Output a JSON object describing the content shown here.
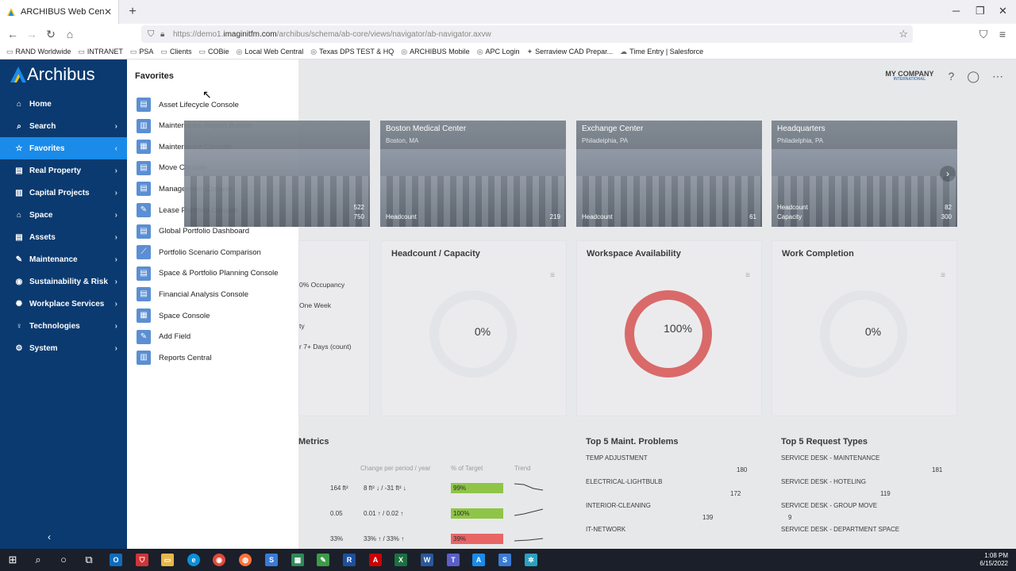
{
  "browser": {
    "tab_title": "ARCHIBUS Web Central:Home",
    "url_prefix": "https://demo1.",
    "url_host": "imaginitfm.com",
    "url_path": "/archibus/schema/ab-core/views/navigator/ab-navigator.axvw",
    "bookmarks": [
      {
        "icon": "folder-icon",
        "label": "RAND Worldwide"
      },
      {
        "icon": "folder-icon",
        "label": "INTRANET"
      },
      {
        "icon": "folder-icon",
        "label": "PSA"
      },
      {
        "icon": "folder-icon",
        "label": "Clients"
      },
      {
        "icon": "folder-icon",
        "label": "COBie"
      },
      {
        "icon": "globe-icon",
        "label": "Local Web Central"
      },
      {
        "icon": "globe-icon",
        "label": "Texas DPS TEST & HQ"
      },
      {
        "icon": "globe-icon",
        "label": "ARCHIBUS Mobile"
      },
      {
        "icon": "globe-icon",
        "label": "APC Login"
      },
      {
        "icon": "serraview-icon",
        "label": "Serraview CAD Prepar..."
      },
      {
        "icon": "salesforce-icon",
        "label": "Time Entry | Salesforce"
      }
    ]
  },
  "app": {
    "brand": "Archibus",
    "nav": [
      {
        "icon": "home-icon",
        "label": "Home",
        "chev": ""
      },
      {
        "icon": "search-icon",
        "label": "Search",
        "chev": "›"
      },
      {
        "icon": "star-icon",
        "label": "Favorites",
        "chev": "‹"
      },
      {
        "icon": "building-icon",
        "label": "Real Property",
        "chev": "›"
      },
      {
        "icon": "chart-icon",
        "label": "Capital Projects",
        "chev": "›"
      },
      {
        "icon": "space-icon",
        "label": "Space",
        "chev": "›"
      },
      {
        "icon": "assets-icon",
        "label": "Assets",
        "chev": "›"
      },
      {
        "icon": "wrench-icon",
        "label": "Maintenance",
        "chev": "›"
      },
      {
        "icon": "globe-icon",
        "label": "Sustainability & Risk",
        "chev": "›"
      },
      {
        "icon": "services-icon",
        "label": "Workplace Services",
        "chev": "›"
      },
      {
        "icon": "bulb-icon",
        "label": "Technologies",
        "chev": "›"
      },
      {
        "icon": "gear-icon",
        "label": "System",
        "chev": "›"
      }
    ],
    "favorites_title": "Favorites",
    "favorites": [
      "Asset Lifecycle Console",
      "Maintenance Report Builder",
      "Maintenance Console",
      "Move Console",
      "Management Console",
      "Lease Portfolio Console",
      "Global Portfolio Dashboard",
      "Portfolio Scenario Comparison",
      "Space & Portfolio Planning Console",
      "Financial Analysis Console",
      "Space Console",
      "Add Field",
      "Reports Central"
    ]
  },
  "dashboard": {
    "company": "MY COMPANY",
    "company_sub": "INTERNATIONAL",
    "buildings": [
      {
        "name": "",
        "location": "",
        "row1_label": "",
        "row1_value": "522",
        "row2_label": "",
        "row2_value": "750"
      },
      {
        "name": "Boston Medical Center",
        "location": "Boston, MA",
        "row1_label": "Headcount",
        "row1_value": "219"
      },
      {
        "name": "Exchange Center",
        "location": "Philadelphia, PA",
        "row1_label": "Headcount",
        "row1_value": "61"
      },
      {
        "name": "Headquarters",
        "location": "Philadelphia, PA",
        "row1_label": "Headcount",
        "row1_value": "82",
        "row2_label": "Capacity",
        "row2_value": "300"
      }
    ],
    "occupancy_lines": [
      "0% Occupancy",
      "One Week",
      "ty",
      "r 7+ Days (count)"
    ],
    "headcount_title": "Headcount / Capacity",
    "headcount_value": "0%",
    "workspace_title": "Workspace Availability",
    "workspace_value": "100%",
    "work_title": "Work Completion",
    "work_value": "0%",
    "metrics_title": "Metrics",
    "metrics_headers": {
      "change": "Change per period / year",
      "target": "% of Target",
      "trend": "Trend"
    },
    "metrics_rows": [
      {
        "value": "164 ft²",
        "change": "8 ft² ↓ / -31 ft² ↓",
        "pct": "99%",
        "pct_color": "#8cc43f"
      },
      {
        "value": "0.05",
        "change": "0.01 ↑ / 0.02 ↑",
        "pct": "100%",
        "pct_color": "#8cc43f"
      },
      {
        "value": "33%",
        "change": "33% ↑ / 33% ↑",
        "pct": "39%",
        "pct_color": "#e86060"
      }
    ],
    "maint_title": "Top 5 Maint. Problems",
    "maint_items": [
      {
        "label": "TEMP ADJUSTMENT",
        "value": "180"
      },
      {
        "label": "ELECTRICAL-LIGHTBULB",
        "value": "172"
      },
      {
        "label": "INTERIOR-CLEANING",
        "value": "139"
      },
      {
        "label": "IT-NETWORK",
        "value": ""
      }
    ],
    "request_title": "Top 5 Request Types",
    "request_items": [
      {
        "label": "SERVICE DESK - MAINTENANCE",
        "value": "181"
      },
      {
        "label": "SERVICE DESK - HOTELING",
        "value": "119"
      },
      {
        "label": "SERVICE DESK - GROUP MOVE",
        "value": "9"
      },
      {
        "label": "SERVICE DESK - DEPARTMENT SPACE",
        "value": ""
      }
    ]
  },
  "taskbar": {
    "time": "1:08 PM",
    "date": "6/15/2022"
  }
}
